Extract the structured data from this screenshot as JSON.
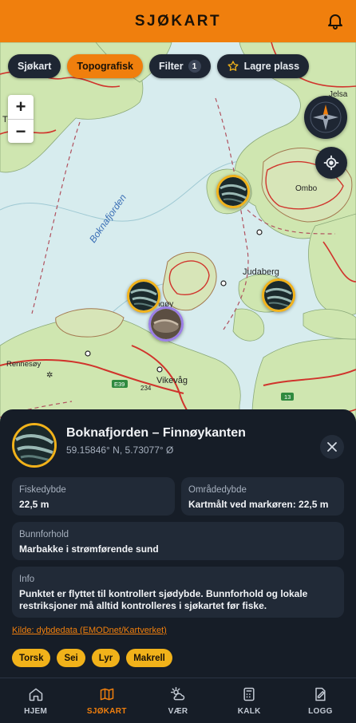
{
  "app": {
    "title": "SJØKART"
  },
  "chips": [
    {
      "label": "Sjøkart",
      "active": false
    },
    {
      "label": "Topografisk",
      "active": true
    },
    {
      "label": "Filter",
      "badge": "1"
    },
    {
      "label": "Lagre plass",
      "icon": "star-icon"
    }
  ],
  "zoom": {
    "in_label": "+",
    "out_label": "−"
  },
  "map_labels": {
    "fjord": "Boknafjorden",
    "ombo": "Ombo",
    "judaberg": "Judaberg",
    "rennesoy": "Rennesøy",
    "vikevag": "Vikevåg",
    "jelsa": "Jelsa",
    "road_e39": "E39",
    "road_13": "13",
    "road_234": "234",
    "partial_t": "T",
    "partial_ngoy": "ngøy"
  },
  "detail": {
    "title": "Boknafjorden – Finnøykanten",
    "coords": "59.15846° N, 5.73077° Ø",
    "fields": {
      "fiskedybde_label": "Fiskedybde",
      "fiskedybde_value": "22,5 m",
      "omradedybde_label": "Områdedybde",
      "omradedybde_value": "Kartmålt ved markøren: 22,5 m",
      "bunnforhold_label": "Bunnforhold",
      "bunnforhold_value": "Marbakke i strømførende sund",
      "info_label": "Info",
      "info_value": "Punktet er flyttet til kontrollert sjødybde. Bunnforhold og lokale restriksjoner må alltid kontrolleres i sjøkartet før fiske."
    },
    "source_link": "Kilde: dybdedata (EMODnet/Kartverket)",
    "species": [
      "Torsk",
      "Sei",
      "Lyr",
      "Makrell"
    ]
  },
  "nav": [
    {
      "label": "HJEM",
      "icon": "home-icon",
      "active": false
    },
    {
      "label": "SJØKART",
      "icon": "map-icon",
      "active": true
    },
    {
      "label": "VÆR",
      "icon": "weather-icon",
      "active": false
    },
    {
      "label": "KALK",
      "icon": "calculator-icon",
      "active": false
    },
    {
      "label": "LOGG",
      "icon": "logbook-icon",
      "active": false
    }
  ],
  "colors": {
    "accent": "#f07f0d",
    "marker": "#f1b21a",
    "selected_marker": "#9b7ee6",
    "sea": "#d7ecee",
    "land": "#cfe6b0",
    "road": "#d0342c"
  }
}
